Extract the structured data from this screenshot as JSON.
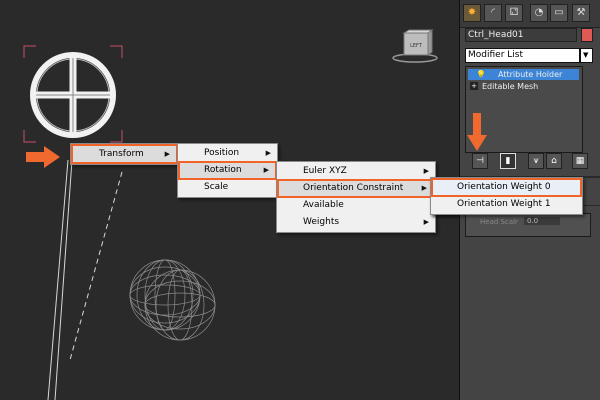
{
  "colors": {
    "accent_orange": "#f0642a",
    "viewport_bg": "#2a2a2a",
    "panel_bg": "#444444",
    "selection_blue": "#3c84d6",
    "color_swatch": "#e05a55"
  },
  "viewcube": {
    "label": "LEFT"
  },
  "menus": {
    "level1": {
      "items": [
        {
          "label": "Transform",
          "has_submenu": true
        }
      ]
    },
    "level2": {
      "items": [
        {
          "label": "Position",
          "has_submenu": true
        },
        {
          "label": "Rotation",
          "has_submenu": true
        },
        {
          "label": "Scale",
          "has_submenu": false
        }
      ]
    },
    "level3": {
      "items": [
        {
          "label": "Euler XYZ",
          "has_submenu": true
        },
        {
          "label": "Orientation Constraint",
          "has_submenu": true
        },
        {
          "label": "Available",
          "has_submenu": false
        },
        {
          "label": "Weights",
          "has_submenu": true
        }
      ]
    },
    "level4": {
      "items": [
        {
          "label": "Orientation Weight 0"
        },
        {
          "label": "Orientation Weight 1"
        }
      ]
    },
    "submenu_arrow": "▶"
  },
  "command_panel": {
    "tab_icons": [
      "sun-icon",
      "modify-icon",
      "hierarchy-icon",
      "motion-icon",
      "display-icon",
      "utilities-icon"
    ],
    "object_name": "Ctrl_Head01",
    "modifier_list": "Modifier List",
    "modifier_stack": [
      {
        "label": "Attribute Holder",
        "selected": true,
        "icon": "lightbulb-icon"
      },
      {
        "label": "Editable Mesh",
        "selected": false,
        "icon": "plus-icon"
      }
    ],
    "rollout_partial_label": "Head Scalr",
    "rollout_partial_value": "0.0"
  }
}
